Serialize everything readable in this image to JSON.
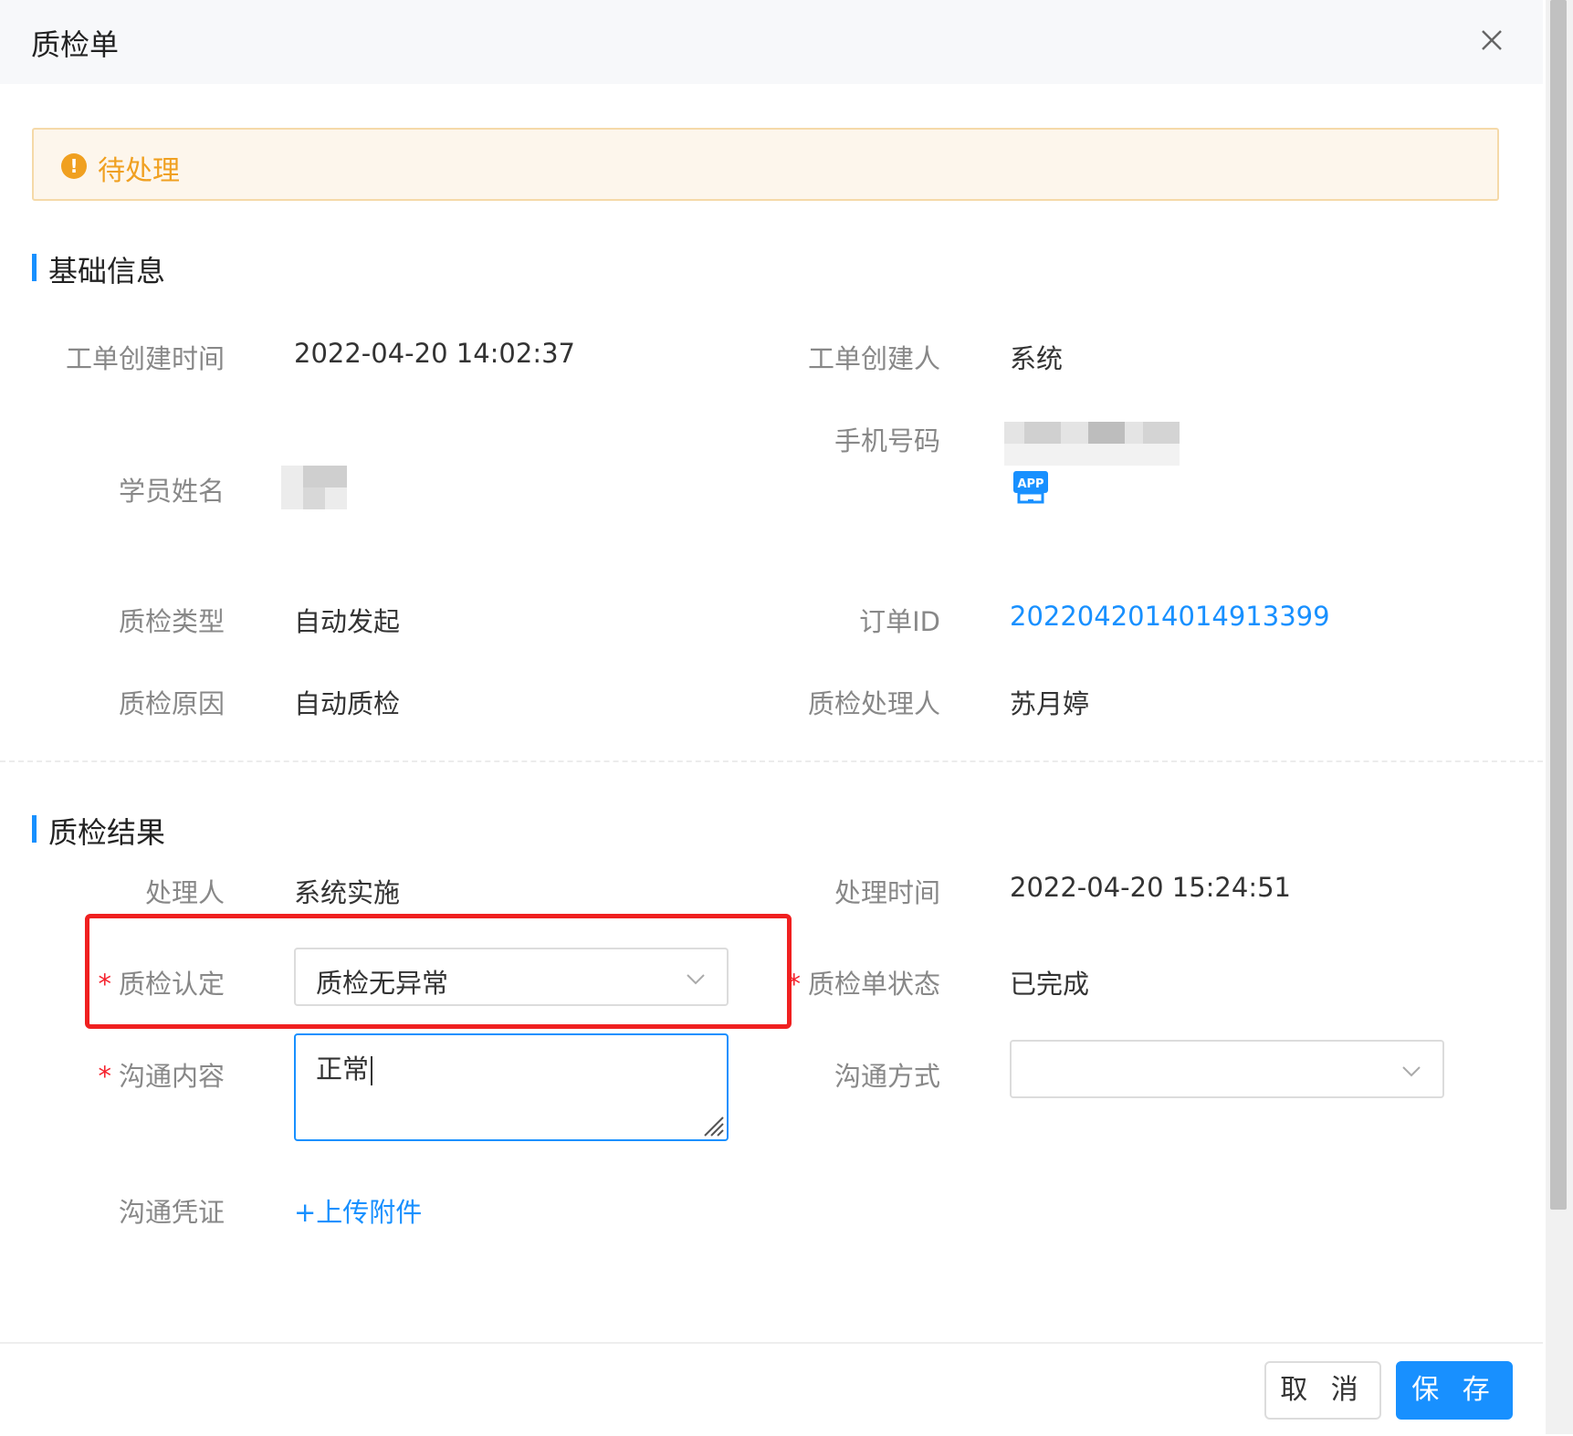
{
  "header": {
    "title": "质检单"
  },
  "alert": {
    "text": "待处理",
    "icon": "warning-icon",
    "color": "#f0a020"
  },
  "basic_info": {
    "section_title": "基础信息",
    "create_time_label": "工单创建时间",
    "create_time_value": "2022-04-20 14:02:37",
    "creator_label": "工单创建人",
    "creator_value": "系统",
    "phone_label": "手机号码",
    "student_name_label": "学员姓名",
    "app_badge": "APP",
    "qc_type_label": "质检类型",
    "qc_type_value": "自动发起",
    "order_id_label": "订单ID",
    "order_id_value": "2022042014014913399",
    "qc_reason_label": "质检原因",
    "qc_reason_value": "自动质检",
    "qc_handler_label": "质检处理人",
    "qc_handler_value": "苏月婷"
  },
  "qc_result": {
    "section_title": "质检结果",
    "processor_label": "处理人",
    "processor_value": "系统实施",
    "process_time_label": "处理时间",
    "process_time_value": "2022-04-20 15:24:51",
    "required_mark": "*",
    "qc_determination_label": "质检认定",
    "qc_determination_value": "质检无异常",
    "qc_status_label": "质检单状态",
    "qc_status_value": "已完成",
    "comm_content_label": "沟通内容",
    "comm_content_value": "正常",
    "comm_method_label": "沟通方式",
    "comm_method_value": "",
    "comm_proof_label": "沟通凭证",
    "upload_link": "+上传附件"
  },
  "footer": {
    "cancel_label": "取 消",
    "save_label": "保 存"
  },
  "colors": {
    "primary": "#1890ff",
    "danger": "#f5222d",
    "highlight": "#f02020"
  }
}
